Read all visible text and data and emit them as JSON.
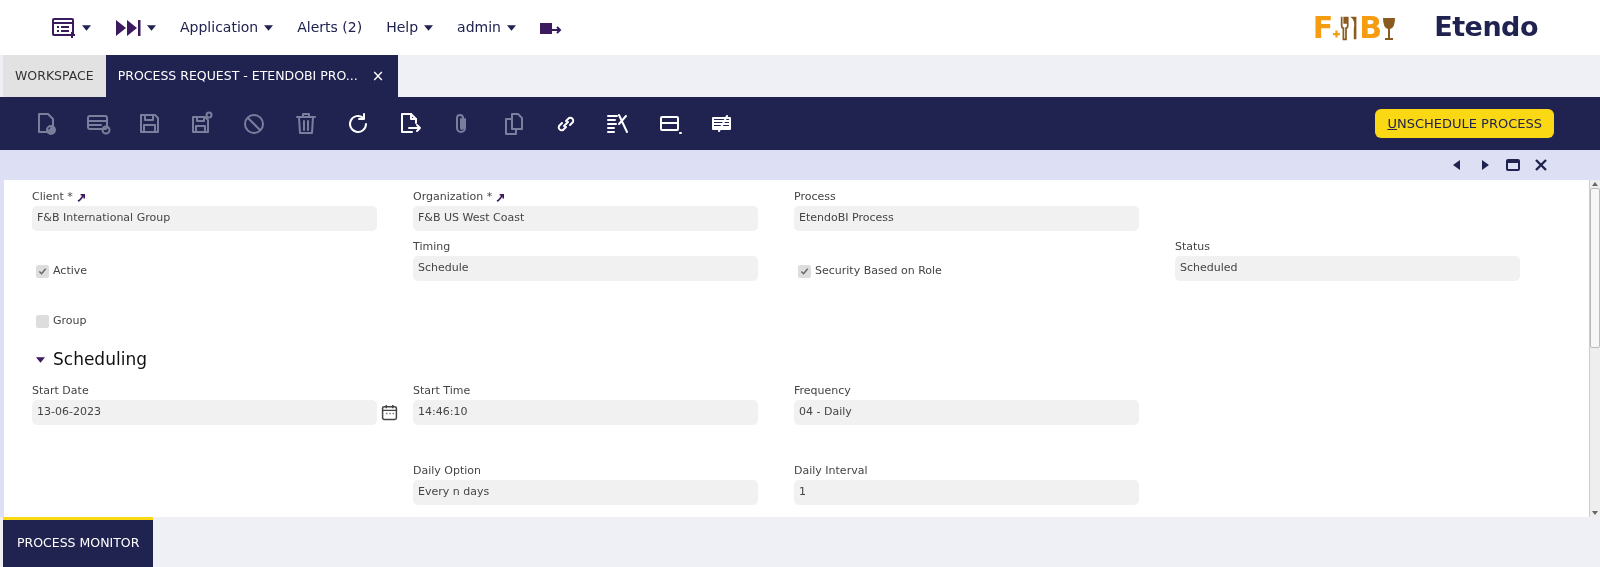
{
  "top_nav": {
    "menus": [
      {
        "kind": "list-icon",
        "caret": true
      },
      {
        "kind": "forward-icon",
        "caret": true
      },
      {
        "kind": "text",
        "label": "Application",
        "caret": true
      },
      {
        "kind": "text",
        "label": "Alerts (2)",
        "caret": false
      },
      {
        "kind": "text",
        "label": "Help",
        "caret": true
      },
      {
        "kind": "text",
        "label": "admin",
        "caret": true
      },
      {
        "kind": "logout-icon",
        "caret": false
      }
    ],
    "logo": {
      "letters": [
        "F",
        "B"
      ]
    },
    "brand": "Etendo"
  },
  "tabs": [
    {
      "label": "WORKSPACE",
      "selected": false
    },
    {
      "label": "PROCESS REQUEST - ETENDOBI PRO...",
      "selected": true,
      "close": "×"
    }
  ],
  "toolbar": {
    "buttons": [
      {
        "kind": "new-doc",
        "disabled": true
      },
      {
        "kind": "new-row",
        "disabled": true
      },
      {
        "kind": "save",
        "disabled": true
      },
      {
        "kind": "save-close",
        "disabled": true
      },
      {
        "kind": "cancel",
        "disabled": true
      },
      {
        "kind": "delete",
        "disabled": true
      },
      {
        "kind": "refresh",
        "disabled": false
      },
      {
        "kind": "export",
        "disabled": false
      },
      {
        "kind": "attach",
        "disabled": true
      },
      {
        "kind": "clone",
        "disabled": true
      },
      {
        "kind": "link",
        "disabled": false
      },
      {
        "kind": "tools",
        "disabled": false
      },
      {
        "kind": "grid",
        "disabled": false
      },
      {
        "kind": "notes",
        "disabled": false
      }
    ],
    "action": {
      "label": "UNSCHEDULE PROCESS",
      "mnemonic": true
    }
  },
  "form": {
    "sections": [
      {
        "rows": [
          {
            "cells": [
              {
                "kind": "field",
                "label": "Client *",
                "link": true,
                "value": "F&B International Group"
              },
              {
                "kind": "field",
                "label": "Organization *",
                "link": true,
                "value": "F&B US West Coast"
              },
              {
                "kind": "field",
                "label": "Process",
                "link": false,
                "value": "EtendoBI Process"
              }
            ]
          },
          {
            "cells": [
              {
                "kind": "checkbox",
                "label": "Active",
                "checked": true
              },
              {
                "kind": "field",
                "label": "Timing",
                "link": false,
                "value": "Schedule"
              },
              {
                "kind": "checkbox",
                "label": "Security Based on Role",
                "checked": true
              },
              {
                "kind": "field",
                "label": "Status",
                "link": false,
                "value": "Scheduled"
              }
            ]
          },
          {
            "cells": [
              {
                "kind": "checkbox",
                "label": "Group",
                "checked": false
              }
            ]
          }
        ]
      },
      {
        "title": "Scheduling",
        "expanded": true,
        "rows": [
          {
            "cells": [
              {
                "kind": "date",
                "label": "Start Date",
                "value": "13-06-2023"
              },
              {
                "kind": "field",
                "label": "Start Time",
                "link": false,
                "value": "14:46:10"
              },
              {
                "kind": "field",
                "label": "Frequency",
                "link": false,
                "value": "04 - Daily"
              }
            ]
          },
          {
            "cells": [
              {
                "kind": "blank"
              },
              {
                "kind": "field",
                "label": "Daily Option",
                "link": false,
                "value": "Every n days"
              },
              {
                "kind": "field",
                "label": "Daily Interval",
                "link": false,
                "value": "1"
              }
            ]
          }
        ]
      }
    ]
  },
  "bottom_tabs": [
    {
      "label": "PROCESS MONITOR",
      "selected": true
    }
  ]
}
